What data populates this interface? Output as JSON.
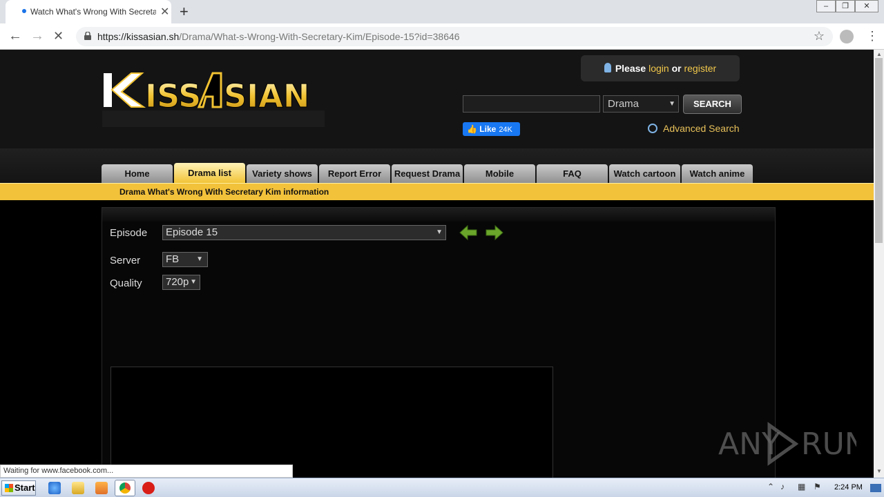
{
  "browser": {
    "tab_title": "Watch What's Wrong With Secretary",
    "tab_close": "✕",
    "new_tab": "+",
    "url_host": "https://kissasian.sh",
    "url_path": "/Drama/What-s-Wrong-With-Secretary-Kim/Episode-15?id=38646",
    "back": "←",
    "forward": "→",
    "stop": "✕",
    "star": "☆",
    "menu": "⋮",
    "status_text": "Waiting for www.facebook.com..."
  },
  "header": {
    "login_prefix": "Please",
    "login_link": "login",
    "login_or": "or",
    "register_link": "register",
    "search_select": "Drama",
    "search_button": "SEARCH",
    "fb_like": "Like",
    "fb_count": "24K",
    "advanced_search": "Advanced Search",
    "logo_text": "KISSASIAN"
  },
  "nav": {
    "tabs": [
      {
        "label": "Home"
      },
      {
        "label": "Drama list"
      },
      {
        "label": "Variety shows"
      },
      {
        "label": "Report Error"
      },
      {
        "label": "Request Drama"
      },
      {
        "label": "Mobile"
      },
      {
        "label": "FAQ"
      },
      {
        "label": "Watch cartoon"
      },
      {
        "label": "Watch anime"
      }
    ],
    "active_index": 1
  },
  "info_bar": "Drama What's Wrong With Secretary Kim information",
  "player": {
    "episode_label": "Episode",
    "episode_value": "Episode 15",
    "server_label": "Server",
    "server_value": "FB",
    "quality_label": "Quality",
    "quality_value": "720p"
  },
  "watermark": {
    "text_left": "ANY",
    "text_right": "RUN"
  },
  "taskbar": {
    "start": "Start",
    "clock": "2:24 PM"
  },
  "colors": {
    "accent_yellow": "#f3c23b",
    "link_yellow": "#f2c84b",
    "page_bg": "#000000",
    "header_bg": "#141414"
  }
}
